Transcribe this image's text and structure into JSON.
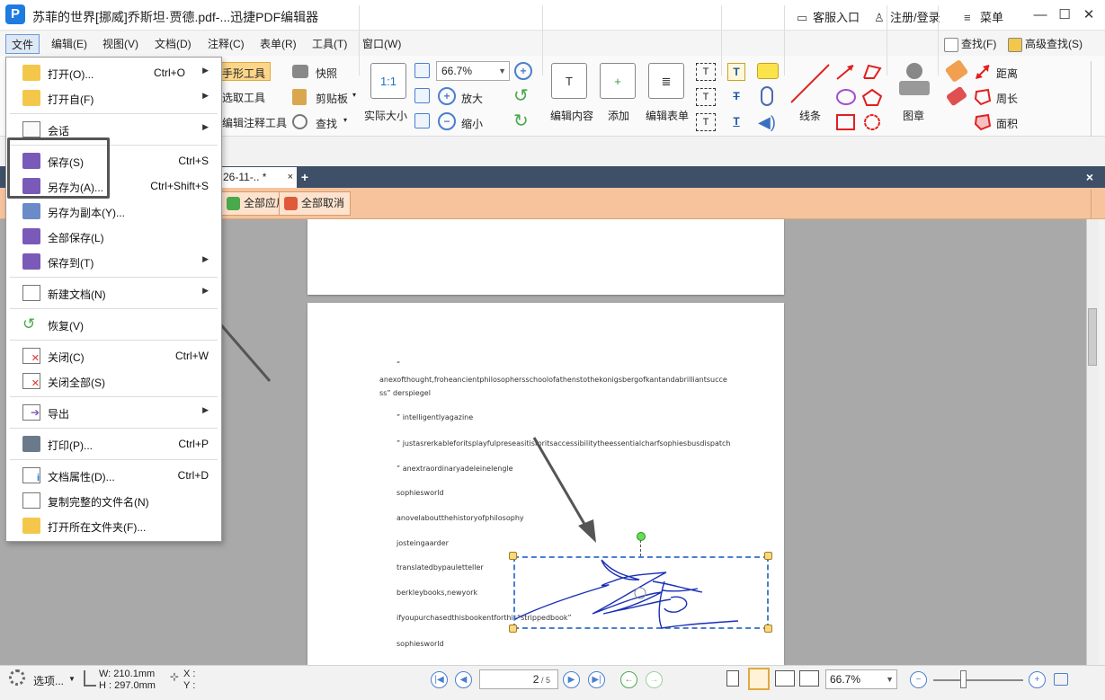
{
  "window": {
    "title": "苏菲的世界[挪威]乔斯坦·贾德.pdf-...迅捷PDF编辑器",
    "support": "客服入口",
    "login": "注册/登录",
    "menu": "菜单"
  },
  "menubar": {
    "items": [
      "文件",
      "编辑(E)",
      "视图(V)",
      "文档(D)",
      "注释(C)",
      "表单(R)",
      "工具(T)",
      "窗口(W)"
    ],
    "find": "查找(F)",
    "advanced_find": "高级查找(S)"
  },
  "ribbon": {
    "hand_tool": "手形工具",
    "select_tool": "选取工具",
    "edit_annotation_tool": "编辑注释工具",
    "snapshot": "快照",
    "clipboard": "剪贴板",
    "find": "查找",
    "actual_size": "实际大小",
    "actual_size_icon": "1:1",
    "zoom_value": "66.7%",
    "zoom_in": "放大",
    "zoom_out": "缩小",
    "edit_content": "编辑内容",
    "add": "添加",
    "edit_form": "编辑表单",
    "lines": "线条",
    "stamp": "图章",
    "distance": "距离",
    "perimeter": "周长",
    "area": "面积"
  },
  "tab": {
    "label": "26-11-..  *",
    "close": "×",
    "add": "+",
    "close_all": "×"
  },
  "orange_toolbar": {
    "apply_all": "全部应用",
    "cancel_all": "全部取消"
  },
  "file_menu": {
    "items": [
      {
        "label": "打开(O)...",
        "shortcut": "Ctrl+O",
        "arrow": "▶"
      },
      {
        "label": "打开自(F)",
        "shortcut": "",
        "arrow": "▶"
      },
      {
        "label": "会话",
        "shortcut": "",
        "arrow": "▶"
      },
      {
        "label": "保存(S)",
        "shortcut": "Ctrl+S",
        "arrow": ""
      },
      {
        "label": "另存为(A)...",
        "shortcut": "Ctrl+Shift+S",
        "arrow": ""
      },
      {
        "label": "另存为副本(Y)...",
        "shortcut": "",
        "arrow": ""
      },
      {
        "label": "全部保存(L)",
        "shortcut": "",
        "arrow": ""
      },
      {
        "label": "保存到(T)",
        "shortcut": "",
        "arrow": "▶"
      },
      {
        "label": "新建文档(N)",
        "shortcut": "",
        "arrow": "▶"
      },
      {
        "label": "恢复(V)",
        "shortcut": "",
        "arrow": ""
      },
      {
        "label": "关闭(C)",
        "shortcut": "Ctrl+W",
        "arrow": ""
      },
      {
        "label": "关闭全部(S)",
        "shortcut": "",
        "arrow": ""
      },
      {
        "label": "导出",
        "shortcut": "",
        "arrow": "▶"
      },
      {
        "label": "打印(P)...",
        "shortcut": "Ctrl+P",
        "arrow": ""
      },
      {
        "label": "文档属性(D)...",
        "shortcut": "Ctrl+D",
        "arrow": ""
      },
      {
        "label": "复制完整的文件名(N)",
        "shortcut": "",
        "arrow": ""
      },
      {
        "label": "打开所在文件夹(F)...",
        "shortcut": "",
        "arrow": ""
      }
    ]
  },
  "document": {
    "lines": [
      "“",
      "anexofthought,froheancientphilosophersschoolofathenstothekonigsbergofkantandabrilliantsucce",
      "ss” derspiegel",
      "” intelligentlyagazine",
      "” justasrerkableforitsplayfulpreseasitisforitsaccessibilitytheessentialcharfsophiesbusdispatch",
      "” anextraordinaryadeleinelengle",
      "sophiesworld",
      "anovelaboutthehistoryofphilosophy",
      "josteingaarder",
      "translatedbypauletteller",
      "berkleybooks,newyork",
      "ifyoupurchasedthisbookentforthis“strippedbook”",
      "sophiesworld"
    ]
  },
  "statusbar": {
    "options": "选项...",
    "width": "W: 210.1mm",
    "height": "H : 297.0mm",
    "x": "X :",
    "y": "Y :",
    "page_value": "2",
    "page_total": "5",
    "zoom": "66.7%"
  },
  "colors": {
    "accent": "#1e7be0",
    "tabbar": "#3e4f68",
    "orange_toolbar": "#f6c39c",
    "doc_background": "#a9a9a9",
    "signature_ink": "#1a2fb8"
  }
}
